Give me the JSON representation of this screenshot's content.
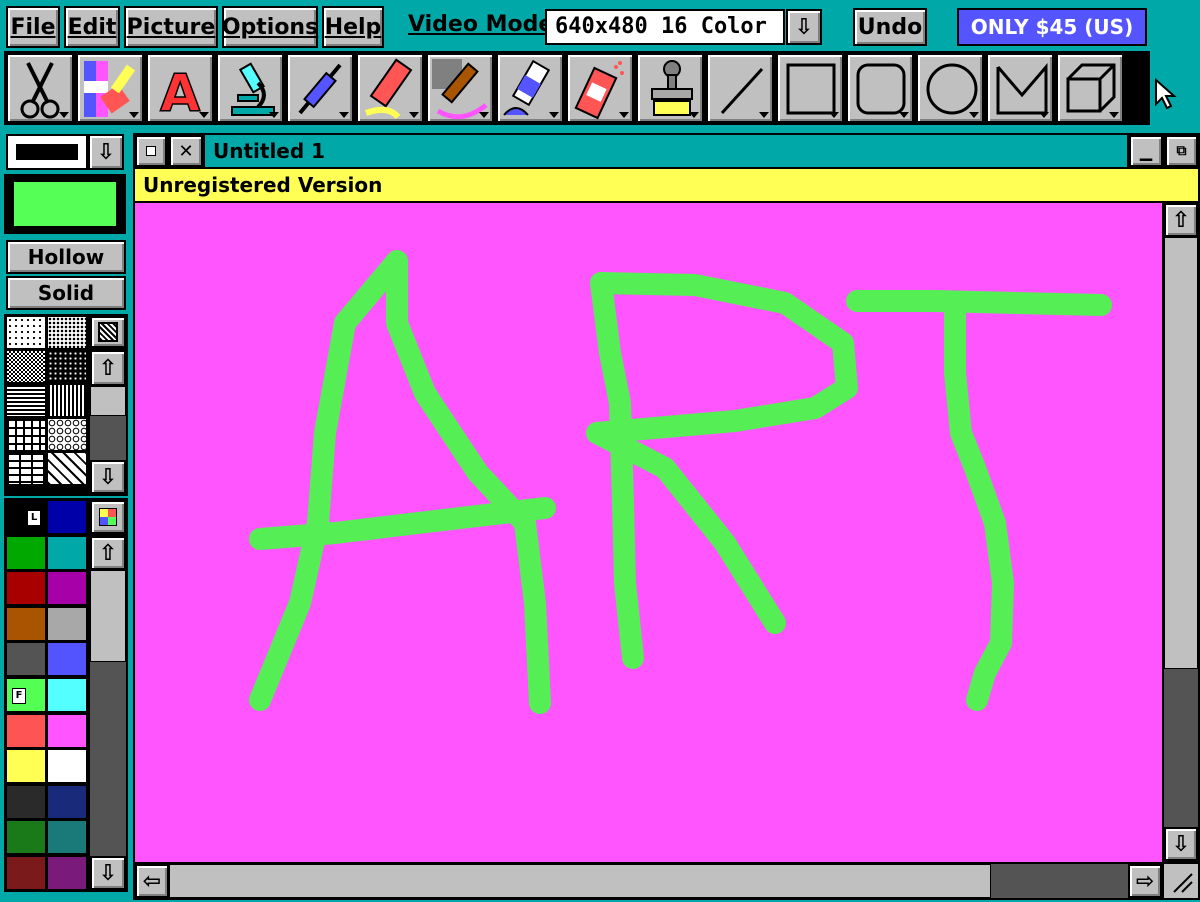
{
  "menu": {
    "file": "File",
    "edit": "Edit",
    "picture": "Picture",
    "options": "Options",
    "help": "Help",
    "video_mode_label": "Video Mode:",
    "video_mode_value": "640x480 16 Color",
    "undo": "Undo",
    "promo": "ONLY $45 (US)"
  },
  "tools": [
    {
      "name": "scissors-icon"
    },
    {
      "name": "color-brush-icon"
    },
    {
      "name": "text-icon"
    },
    {
      "name": "microscope-icon"
    },
    {
      "name": "syringe-icon"
    },
    {
      "name": "marker-icon"
    },
    {
      "name": "brush-icon"
    },
    {
      "name": "paint-tube-icon"
    },
    {
      "name": "spray-can-icon"
    },
    {
      "name": "stamp-icon"
    },
    {
      "name": "line-icon"
    },
    {
      "name": "rectangle-icon"
    },
    {
      "name": "rounded-rectangle-icon"
    },
    {
      "name": "ellipse-icon"
    },
    {
      "name": "polygon-icon"
    },
    {
      "name": "cube-icon"
    }
  ],
  "left_panel": {
    "hollow": "Hollow",
    "solid": "Solid",
    "left_marker": "L",
    "fill_marker": "F",
    "line_color": "#000000",
    "fill_color": "#55ff55"
  },
  "palette": [
    "#000000",
    "#0000a8",
    "#00a800",
    "#00a8a8",
    "#a80000",
    "#a800a8",
    "#a85400",
    "#a8a8a8",
    "#545454",
    "#5454ff",
    "#54ff54",
    "#54ffff",
    "#ff5454",
    "#ff54ff",
    "#ffff54",
    "#ffffff",
    "#2a2a2a",
    "#1a2a7a",
    "#1a7a1a",
    "#1a7a7a",
    "#7a1a1a",
    "#7a1a7a"
  ],
  "window": {
    "title": "Untitled 1",
    "banner": "Unregistered Version"
  },
  "canvas": {
    "background": "#ff55ff",
    "stroke_color": "#55ee55",
    "drawn_text": "ART"
  },
  "colors": {
    "desktop": "#00a8a8",
    "promo_bg": "#5555ff",
    "banner_bg": "#ffff55"
  }
}
